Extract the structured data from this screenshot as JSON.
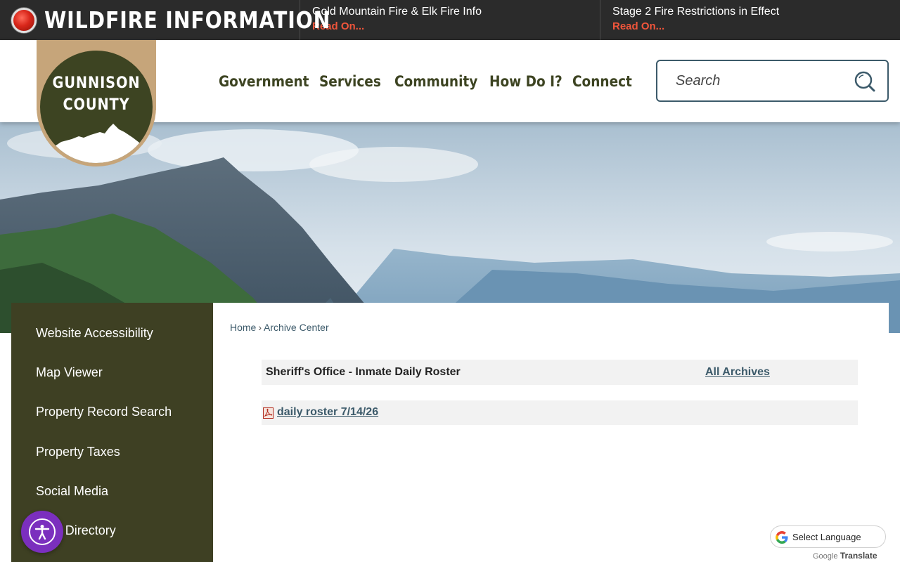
{
  "alert_bar": {
    "heading": "WILDFIRE INFORMATION",
    "items": [
      {
        "title": "Gold Mountain Fire & Elk Fire Info",
        "link": "Read On..."
      },
      {
        "title": "Stage 2 Fire Restrictions in Effect",
        "link": "Read On..."
      }
    ]
  },
  "logo": {
    "line1": "GUNNISON",
    "line2": "COUNTY"
  },
  "nav": {
    "items": [
      "Government",
      "Services",
      "Community",
      "How Do I?",
      "Connect"
    ]
  },
  "search": {
    "placeholder": "Search"
  },
  "sidebar": {
    "items": [
      "Website Accessibility",
      "Map Viewer",
      "Property Record Search",
      "Property Taxes",
      "Social Media",
      "Staff Directory"
    ]
  },
  "breadcrumb": {
    "home": "Home",
    "separator": "›",
    "current": "Archive Center"
  },
  "archive": {
    "title": "Sheriff's Office - Inmate Daily Roster",
    "all_archives": "All Archives",
    "documents": [
      {
        "label": "daily roster 7/14/26",
        "type": "pdf-icon"
      }
    ]
  },
  "translate": {
    "label": "Select Language",
    "powered_by": "Google",
    "translate": "Translate"
  },
  "colors": {
    "alert_bar": "#2b2b2b",
    "alert_link": "#f0553b",
    "brand_green": "#3d4422",
    "logo_tan": "#c6a57a",
    "sidebar": "#3e4023",
    "link_blue": "#3c5a6a",
    "a11y_purple": "#7b2fbe"
  }
}
